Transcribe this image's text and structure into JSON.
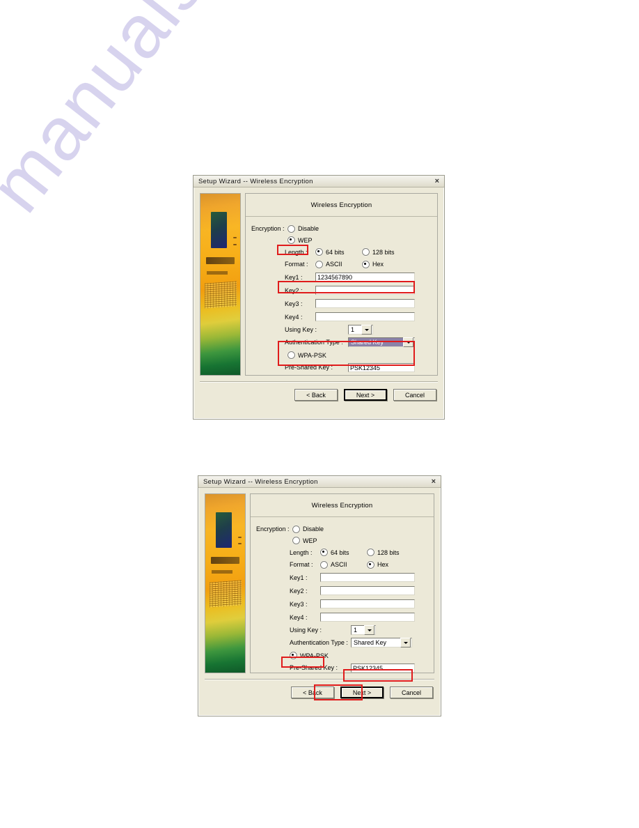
{
  "page": {
    "watermark": "manualshive.com"
  },
  "dialogs": [
    {
      "id": "dialog-wep",
      "title": "Setup Wizard -- Wireless Encryption",
      "close_icon": "×",
      "panel_heading": "Wireless Encryption",
      "encryption_label": "Encryption :",
      "options": {
        "disable": "Disable",
        "wep": "WEP",
        "wpa_psk": "WPA-PSK"
      },
      "selected_encryption": "WEP",
      "length_label": "Length :",
      "length_options": [
        "64 bits",
        "128 bits"
      ],
      "selected_length": "64 bits",
      "format_label": "Format :",
      "format_options": [
        "ASCII",
        "Hex"
      ],
      "selected_format": "Hex",
      "keys": [
        {
          "label": "Key1 :",
          "value": "1234567890"
        },
        {
          "label": "Key2 :",
          "value": ""
        },
        {
          "label": "Key3 :",
          "value": ""
        },
        {
          "label": "Key4 :",
          "value": ""
        }
      ],
      "using_key_label": "Using Key :",
      "using_key_value": "1",
      "auth_type_label": "Authentication Type :",
      "auth_type_value": "Shared Key",
      "auth_type_selected_text": true,
      "psk_label": "Pre-Shared Key :",
      "psk_value": "PSK12345",
      "buttons": {
        "back": "< Back",
        "next": "Next >",
        "cancel": "Cancel"
      },
      "focused_button": "next",
      "highlight_color": "#e01b1b",
      "highlights": [
        "wep-radio",
        "key1-row",
        "using-key-and-auth-block"
      ]
    },
    {
      "id": "dialog-wpa",
      "title": "Setup Wizard -- Wireless Encryption",
      "close_icon": "×",
      "panel_heading": "Wireless Encryption",
      "encryption_label": "Encryption :",
      "options": {
        "disable": "Disable",
        "wep": "WEP",
        "wpa_psk": "WPA-PSK"
      },
      "selected_encryption": "WPA-PSK",
      "length_label": "Length :",
      "length_options": [
        "64 bits",
        "128 bits"
      ],
      "selected_length": "64 bits",
      "format_label": "Format :",
      "format_options": [
        "ASCII",
        "Hex"
      ],
      "selected_format": "Hex",
      "keys": [
        {
          "label": "Key1 :",
          "value": ""
        },
        {
          "label": "Key2 :",
          "value": ""
        },
        {
          "label": "Key3 :",
          "value": ""
        },
        {
          "label": "Key4 :",
          "value": ""
        }
      ],
      "using_key_label": "Using Key :",
      "using_key_value": "1",
      "auth_type_label": "Authentication Type :",
      "auth_type_value": "Shared Key",
      "auth_type_selected_text": false,
      "psk_label": "Pre-Shared Key :",
      "psk_value": "PSK12345",
      "buttons": {
        "back": "< Back",
        "next": "Next >",
        "cancel": "Cancel"
      },
      "focused_button": "next",
      "highlight_color": "#e01b1b",
      "highlights": [
        "wpa-psk-radio",
        "pre-shared-key-row",
        "next-button"
      ]
    }
  ]
}
